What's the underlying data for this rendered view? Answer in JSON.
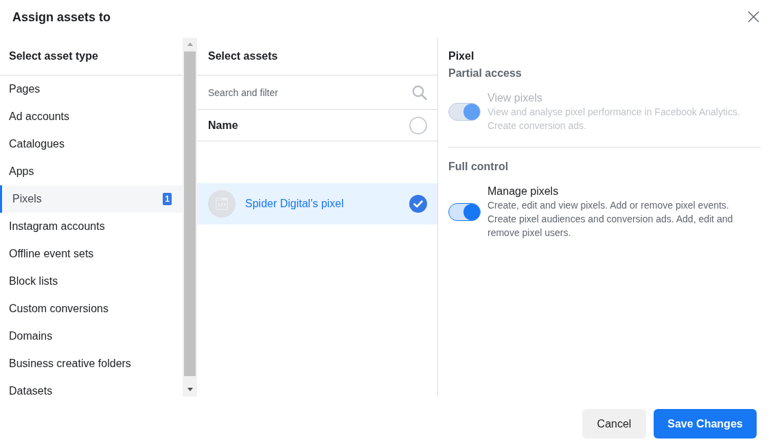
{
  "dialog": {
    "title": "Assign assets to"
  },
  "asset_types": {
    "heading": "Select asset type",
    "items": [
      {
        "label": "Pages",
        "selected": false
      },
      {
        "label": "Ad accounts",
        "selected": false
      },
      {
        "label": "Catalogues",
        "selected": false
      },
      {
        "label": "Apps",
        "selected": false
      },
      {
        "label": "Pixels",
        "selected": true,
        "badge": "1"
      },
      {
        "label": "Instagram accounts",
        "selected": false
      },
      {
        "label": "Offline event sets",
        "selected": false
      },
      {
        "label": "Block lists",
        "selected": false
      },
      {
        "label": "Custom conversions",
        "selected": false
      },
      {
        "label": "Domains",
        "selected": false
      },
      {
        "label": "Business creative folders",
        "selected": false
      },
      {
        "label": "Datasets",
        "selected": false
      }
    ]
  },
  "assets": {
    "heading": "Select assets",
    "search": {
      "placeholder": "Search and filter"
    },
    "name_column": {
      "label": "Name",
      "checked": false
    },
    "rows": [
      {
        "name": "Spider Digital's pixel",
        "selected": true,
        "checked": true
      }
    ]
  },
  "permissions": {
    "title": "Pixel",
    "groups": [
      {
        "heading": "Partial access",
        "options": [
          {
            "label": "View pixels",
            "description": "View and analyse pixel performance in Facebook Analytics. Create conversion ads.",
            "on": true,
            "disabled": true
          }
        ]
      },
      {
        "heading": "Full control",
        "options": [
          {
            "label": "Manage pixels",
            "description": "Create, edit and view pixels. Add or remove pixel events. Create pixel audiences and conversion ads. Add, edit and remove pixel users.",
            "on": true,
            "disabled": false
          }
        ]
      }
    ]
  },
  "buttons": [
    {
      "label": "Cancel",
      "kind": "secondary"
    },
    {
      "label": "Save Changes",
      "kind": "primary"
    }
  ]
}
